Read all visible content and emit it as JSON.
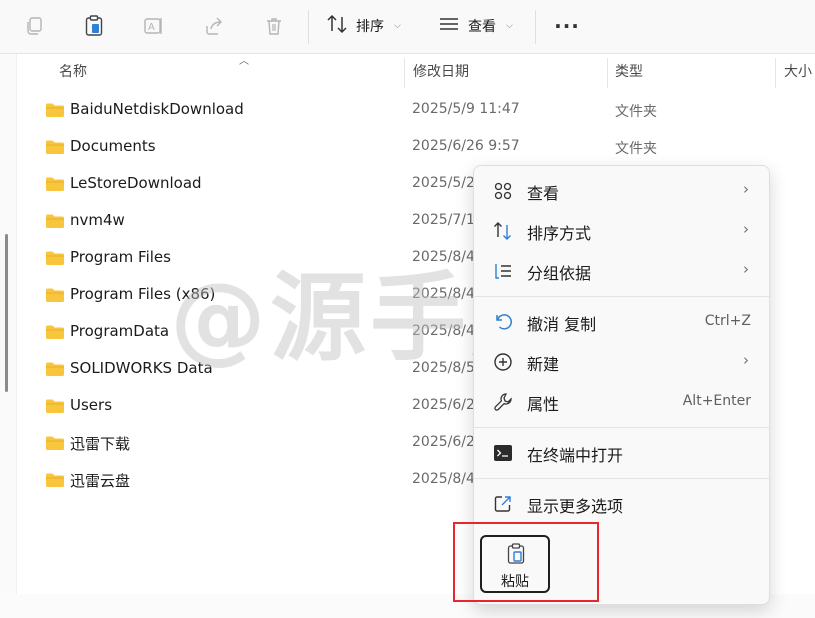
{
  "toolbar": {
    "sort_label": "排序",
    "view_label": "查看",
    "more_label": "···"
  },
  "columns": {
    "name": "名称",
    "date": "修改日期",
    "type": "类型",
    "size": "大小"
  },
  "rows": [
    {
      "name": "BaiduNetdiskDownload",
      "date": "2025/5/9 11:47",
      "type": "文件夹"
    },
    {
      "name": "Documents",
      "date": "2025/6/26 9:57",
      "type": "文件夹"
    },
    {
      "name": "LeStoreDownload",
      "date": "2025/5/2",
      "type": ""
    },
    {
      "name": "nvm4w",
      "date": "2025/7/1",
      "type": ""
    },
    {
      "name": "Program Files",
      "date": "2025/8/4",
      "type": ""
    },
    {
      "name": "Program Files (x86)",
      "date": "2025/8/4",
      "type": ""
    },
    {
      "name": "ProgramData",
      "date": "2025/8/4",
      "type": ""
    },
    {
      "name": "SOLIDWORKS Data",
      "date": "2025/8/5",
      "type": ""
    },
    {
      "name": "Users",
      "date": "2025/6/2",
      "type": ""
    },
    {
      "name": "迅雷下载",
      "date": "2025/6/2",
      "type": ""
    },
    {
      "name": "迅雷云盘",
      "date": "2025/8/4",
      "type": ""
    }
  ],
  "watermark": "@源手风",
  "menu": {
    "view": "查看",
    "sort_by": "排序方式",
    "group_by": "分组依据",
    "undo_copy": "撤消 复制",
    "undo_shortcut": "Ctrl+Z",
    "new": "新建",
    "properties": "属性",
    "properties_shortcut": "Alt+Enter",
    "open_terminal": "在终端中打开",
    "more_options": "显示更多选项",
    "paste": "粘贴",
    "submenu_arrow": "›"
  },
  "colors": {
    "folder": "#f8c63c",
    "highlight": "#e8262c"
  }
}
